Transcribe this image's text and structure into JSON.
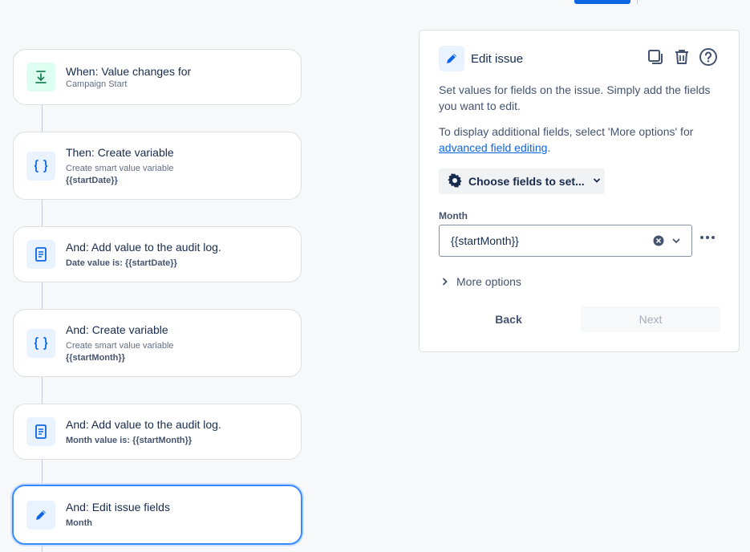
{
  "flow": {
    "cards": [
      {
        "title": "When: Value changes for",
        "sub": "Campaign Start",
        "bold": ""
      },
      {
        "title": "Then: Create variable",
        "sub": "Create smart value variable",
        "bold": "{{startDate}}"
      },
      {
        "title": "And: Add value to the audit log.",
        "sub": "",
        "bold": "Date value is: {{startDate}}"
      },
      {
        "title": "And: Create variable",
        "sub": "Create smart value variable",
        "bold": "{{startMonth}}"
      },
      {
        "title": "And: Add value to the audit log.",
        "sub": "",
        "bold": "Month value is: {{startMonth}}"
      },
      {
        "title": "And: Edit issue fields",
        "sub": "",
        "bold": "Month"
      }
    ]
  },
  "panel": {
    "title": "Edit issue",
    "desc1": "Set values for fields on the issue. Simply add the fields you want to edit.",
    "desc2_prefix": "To display additional fields, select 'More options' for ",
    "desc2_link": "advanced field editing",
    "desc2_suffix": ".",
    "choose_label": "Choose fields to set...",
    "field_label": "Month",
    "field_value": "{{startMonth}}",
    "more_options": "More options",
    "back": "Back",
    "next": "Next"
  },
  "colors": {
    "accent": "#0c66e4",
    "selected_border": "#388bff",
    "trigger_bg": "#dcfff1",
    "action_bg": "#e9f2ff"
  }
}
